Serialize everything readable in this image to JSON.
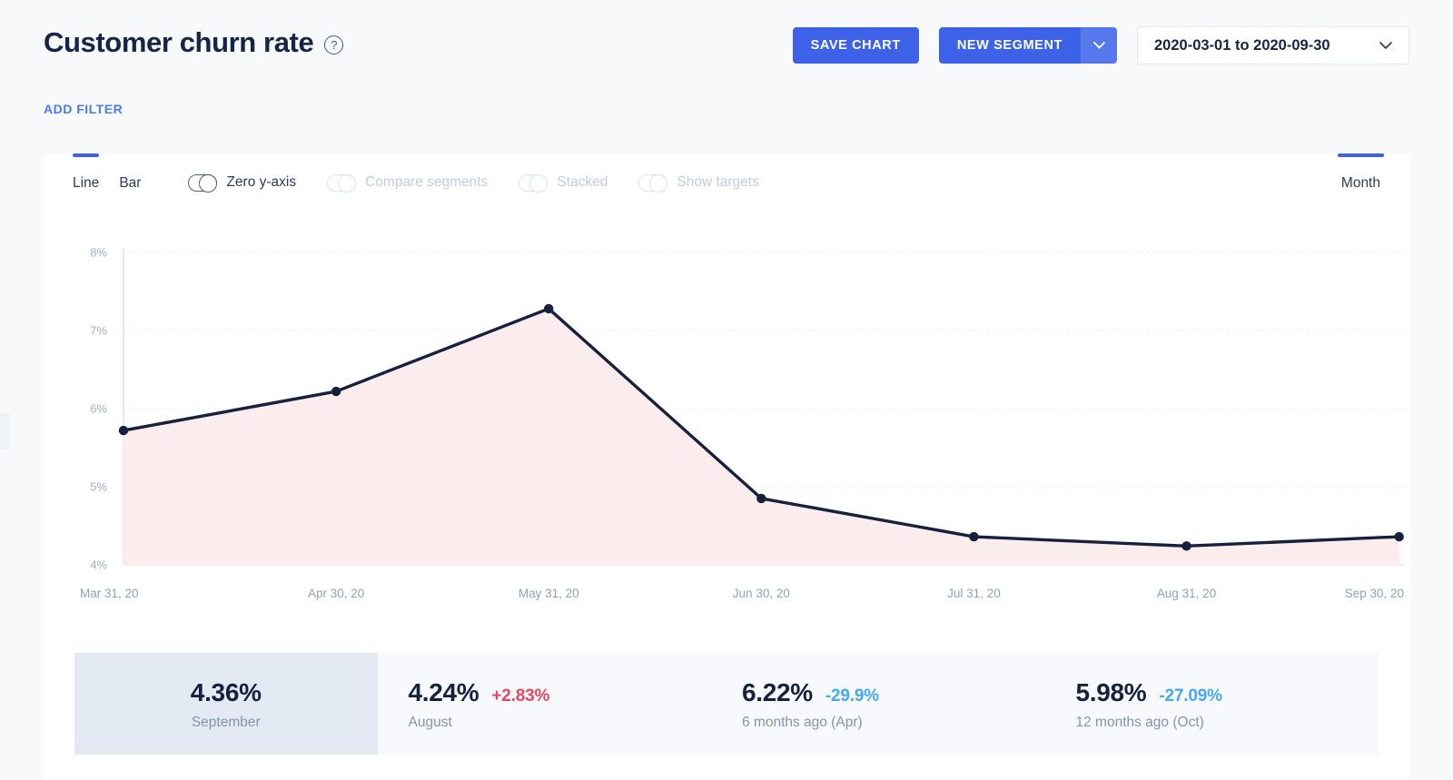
{
  "header": {
    "title": "Customer churn rate",
    "help_icon": "help-circle-icon",
    "save_chart_label": "SAVE CHART",
    "new_segment_label": "NEW SEGMENT",
    "new_segment_caret_icon": "chevron-down-icon",
    "date_range": "2020-03-01 to 2020-09-30",
    "date_caret_icon": "chevron-down-icon",
    "add_filter_label": "ADD FILTER"
  },
  "toolbar": {
    "chart_types": [
      {
        "label": "Line",
        "active": true
      },
      {
        "label": "Bar",
        "active": false
      }
    ],
    "toggles": [
      {
        "label": "Zero y-axis",
        "enabled": true,
        "on": false
      },
      {
        "label": "Compare segments",
        "enabled": false,
        "on": false
      },
      {
        "label": "Stacked",
        "enabled": false,
        "on": false
      },
      {
        "label": "Show targets",
        "enabled": false,
        "on": false
      }
    ],
    "granularity": {
      "label": "Month",
      "active": true
    }
  },
  "chart_data": {
    "type": "line",
    "title": "Customer churn rate",
    "xlabel": "",
    "ylabel": "",
    "categories": [
      "Mar 31, 20",
      "Apr 30, 20",
      "May 31, 20",
      "Jun 30, 20",
      "Jul 31, 20",
      "Aug 31, 20",
      "Sep 30, 20"
    ],
    "values": [
      5.72,
      6.22,
      7.28,
      4.85,
      4.36,
      4.24,
      4.36
    ],
    "ytick_labels": [
      "8%",
      "7%",
      "6%",
      "5%",
      "4%"
    ],
    "yticks": [
      8,
      7,
      6,
      5,
      4
    ],
    "ylim": [
      4,
      8
    ],
    "grid": true,
    "legend": "none",
    "line_color": "#16213d",
    "area_color": "#fbecee",
    "marker_color": "#16213d"
  },
  "summary": [
    {
      "value": "4.36%",
      "delta": "",
      "delta_dir": "",
      "label": "September",
      "highlighted": true
    },
    {
      "value": "4.24%",
      "delta": "+2.83%",
      "delta_dir": "up",
      "label": "August",
      "highlighted": false
    },
    {
      "value": "6.22%",
      "delta": "-29.9%",
      "delta_dir": "down",
      "label": "6 months ago (Apr)",
      "highlighted": false
    },
    {
      "value": "5.98%",
      "delta": "-27.09%",
      "delta_dir": "down",
      "label": "12 months ago (Oct)",
      "highlighted": false
    }
  ],
  "colors": {
    "accent": "#3d62e8",
    "link": "#4a7bf0",
    "page_bg": "#f7f9fb",
    "card_bg": "#ffffff",
    "delta_up": "#f0455f",
    "delta_down": "#45a8f5",
    "highlight_card": "#e3eaf3"
  }
}
